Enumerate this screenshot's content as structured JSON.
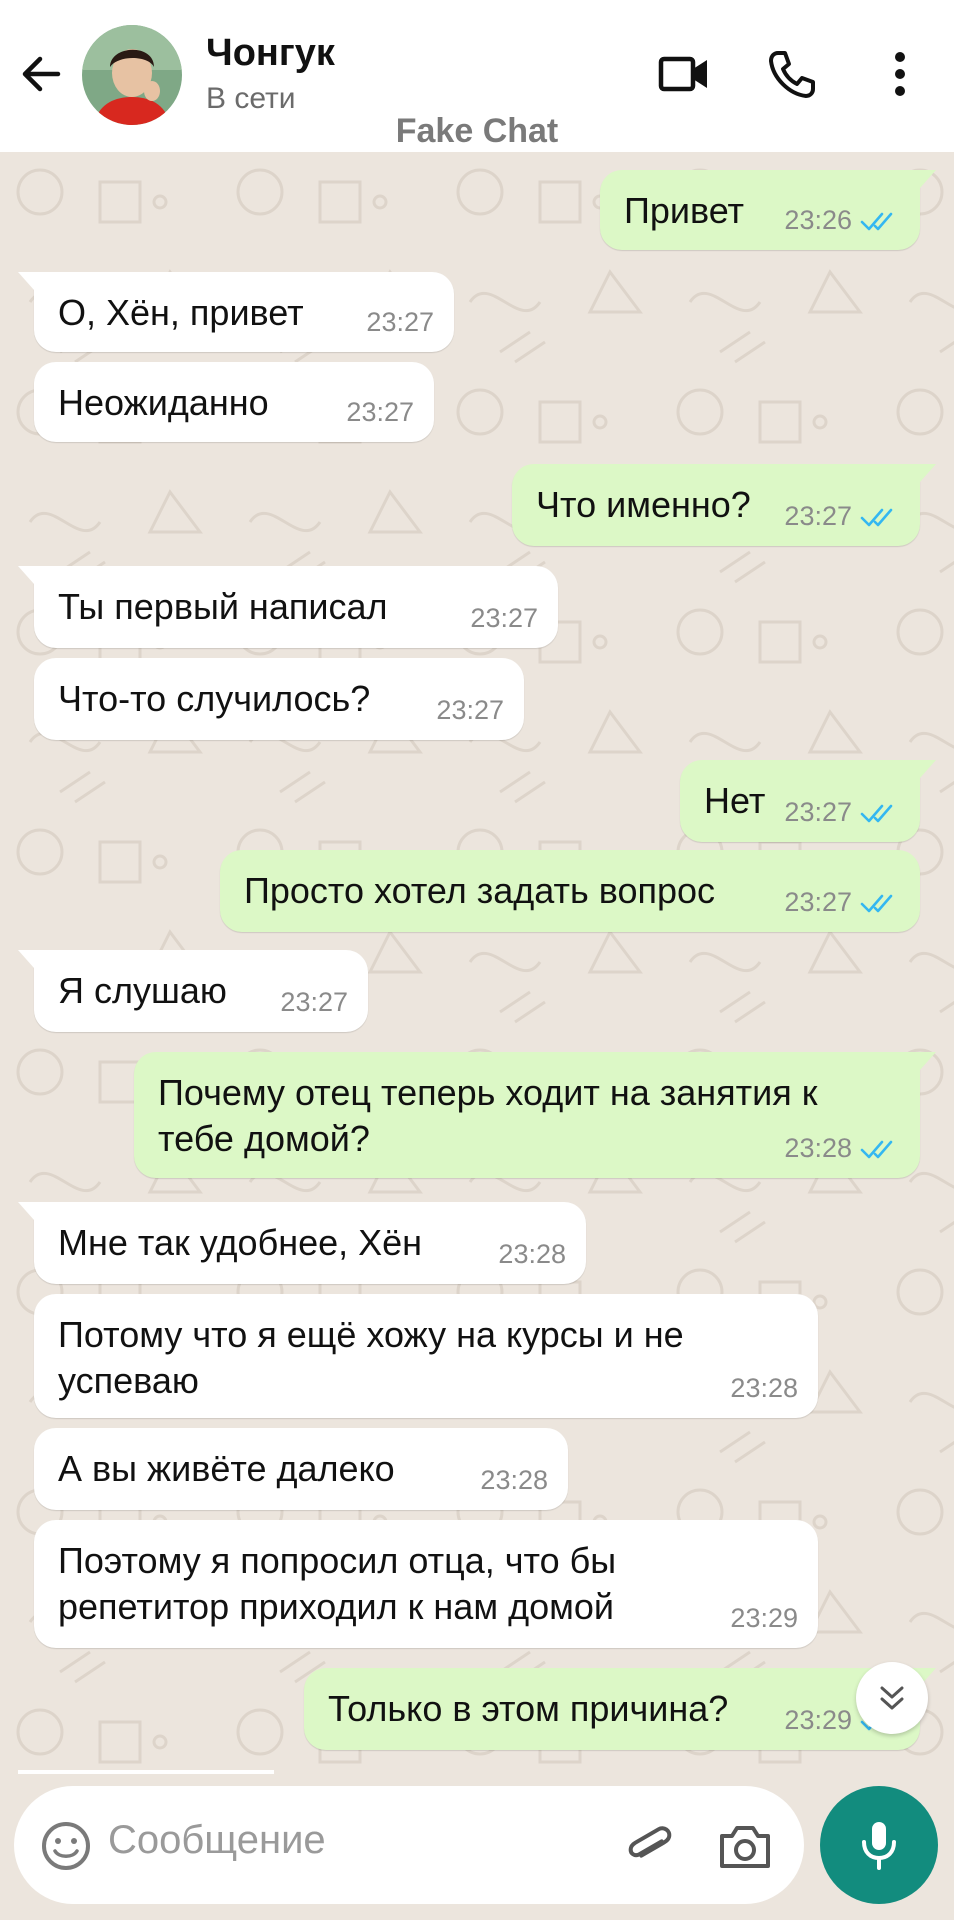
{
  "header": {
    "contact_name": "Чонгук",
    "status": "В сети",
    "watermark": "Fake Chat",
    "icons": [
      "back-arrow-icon",
      "video-call-icon",
      "phone-icon",
      "more-vert-icon"
    ]
  },
  "messages": [
    {
      "dir": "out",
      "text": "Привет",
      "time": "23:26",
      "read": true
    },
    {
      "dir": "in",
      "text": "О, Хён, привет",
      "time": "23:27"
    },
    {
      "dir": "in",
      "text": "Неожиданно",
      "time": "23:27"
    },
    {
      "dir": "out",
      "text": "Что именно?",
      "time": "23:27",
      "read": true
    },
    {
      "dir": "in",
      "text": "Ты первый написал",
      "time": "23:27"
    },
    {
      "dir": "in",
      "text": "Что-то случилось?",
      "time": "23:27"
    },
    {
      "dir": "out",
      "text": "Нет",
      "time": "23:27",
      "read": true
    },
    {
      "dir": "out",
      "text": "Просто хотел задать вопрос",
      "time": "23:27",
      "read": true
    },
    {
      "dir": "in",
      "text": "Я слушаю",
      "time": "23:27"
    },
    {
      "dir": "out",
      "text": "Почему отец теперь ходит на занятия к тебе домой?",
      "time": "23:28",
      "read": true
    },
    {
      "dir": "in",
      "text": "Мне так удобнее, Хён",
      "time": "23:28"
    },
    {
      "dir": "in",
      "text": "Потому что я ещё хожу на курсы и не успеваю",
      "time": "23:28"
    },
    {
      "dir": "in",
      "text": "А вы живёте далеко",
      "time": "23:28"
    },
    {
      "dir": "in",
      "text": "Поэтому я попросил отца, что бы репетитор приходил к нам домой",
      "time": "23:29"
    },
    {
      "dir": "out",
      "text": "Только в этом причина?",
      "time": "23:29",
      "read": true
    }
  ],
  "input": {
    "placeholder": "Сообщение",
    "icons": [
      "emoji-icon",
      "attach-icon",
      "camera-icon",
      "mic-icon"
    ]
  },
  "colors": {
    "incoming_bubble": "#FFFFFF",
    "outgoing_bubble": "#DCF8C6",
    "read_ticks": "#34B7F1",
    "mic_button": "#128C7E",
    "chat_background": "#ECE5DD"
  }
}
